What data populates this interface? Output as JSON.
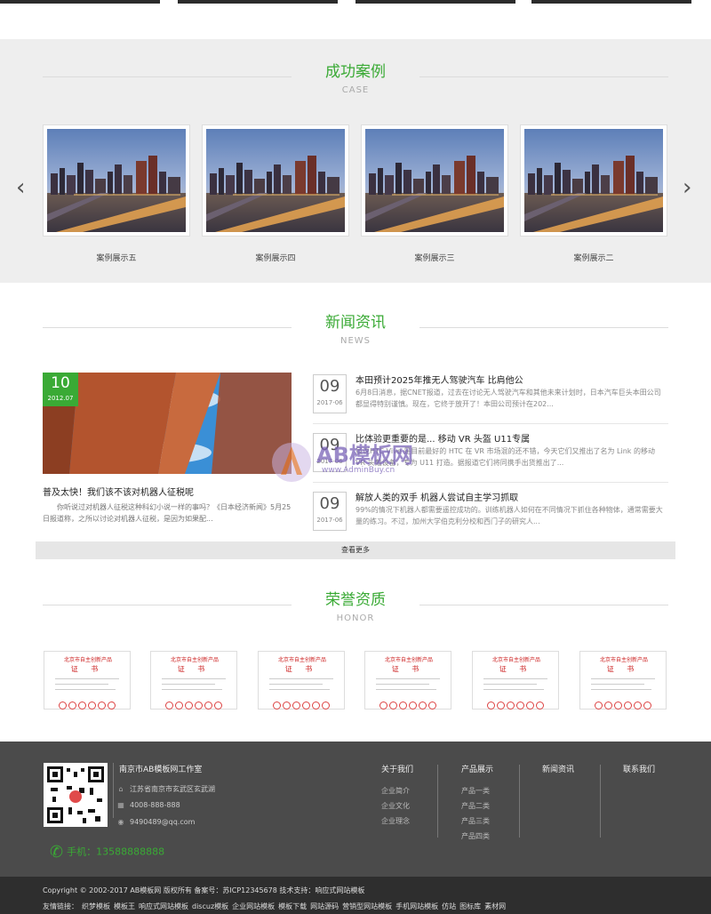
{
  "case": {
    "title": "成功案例",
    "subtitle": "CASE",
    "items": [
      "案例展示五",
      "案例展示四",
      "案例展示三",
      "案例展示二"
    ],
    "prev_icon": "chevron-left-icon",
    "next_icon": "chevron-right-icon"
  },
  "news": {
    "title": "新闻资讯",
    "subtitle": "NEWS",
    "featured": {
      "day": "10",
      "ym": "2012.07",
      "title": "普及太快！我们该不该对机器人征税呢",
      "desc": "你听说过对机器人征税这种科幻小说一样的事吗？《日本经济新闻》5月25日报道称，之所以讨论对机器人征税，是因为如果配..."
    },
    "items": [
      {
        "day": "09",
        "ym": "2017-06",
        "title": "本田预计2025年推无人驾驶汽车 比肩他公",
        "summary": "6月8日消息，据CNET报道，过去在讨论无人驾驶汽车和其他未来计划时，日本汽车巨头本田公司都显得特别谨慎。现在，它终于放开了！本田公司预计在202..."
      },
      {
        "day": "09",
        "ym": "2017-06",
        "title": "比体验更重要的是... 移动 VR 头盔 U11专属",
        "summary": "虽说HTC Vive 是目前最好的 HTC 在 VR 市场混的还不错，今天它们又推出了名为 Link 的移动 VR 头戴设备，专为 U11 打造。据报道它们将同携手出货推出了..."
      },
      {
        "day": "09",
        "ym": "2017-06",
        "title": "解放人类的双手 机器人尝试自主学习抓取",
        "summary": "99%的情况下机器人都需要遥控成功的。训练机器人如何在不同情况下抓住各种物体，通常需要大量的练习。不过，加州大学伯克利分校和西门子的研究人..."
      }
    ],
    "more_label": "查看更多",
    "watermark": "AB模板网",
    "watermark_url": "www.AdminBuy.cn"
  },
  "honor": {
    "title": "荣誉资质",
    "subtitle": "HONOR",
    "cert_title": "北京市自主创新产品",
    "cert_word": "证 书",
    "count": 6
  },
  "footer": {
    "company": "南京市AB模板网工作室",
    "address": "江苏省南京市玄武区玄武湖",
    "tel": "4008-888-888",
    "email": "9490489@qq.com",
    "phone_label": "手机：13588888888",
    "columns": [
      {
        "heading": "关于我们",
        "items": [
          "企业简介",
          "企业文化",
          "企业理念"
        ]
      },
      {
        "heading": "产品展示",
        "items": [
          "产品一类",
          "产品二类",
          "产品三类",
          "产品四类"
        ]
      },
      {
        "heading": "新闻资讯",
        "items": []
      },
      {
        "heading": "联系我们",
        "items": []
      }
    ]
  },
  "bottom": {
    "copyright": "Copyright © 2002-2017 AB模板网 版权所有 备案号：苏ICP12345678 技术支持：响应式网站模板",
    "links_label": "友情链接：",
    "links": [
      "织梦模板",
      "模板王",
      "响应式网站模板",
      "discuz模板",
      "企业网站模板",
      "模板下载",
      "网站源码",
      "营销型网站模板",
      "手机网站模板",
      "仿站",
      "图标库",
      "素材网"
    ]
  },
  "colors": {
    "accent": "#3aaa35",
    "footer_bg": "#4b4b4b",
    "bottom_bg": "#2e2e2e"
  }
}
